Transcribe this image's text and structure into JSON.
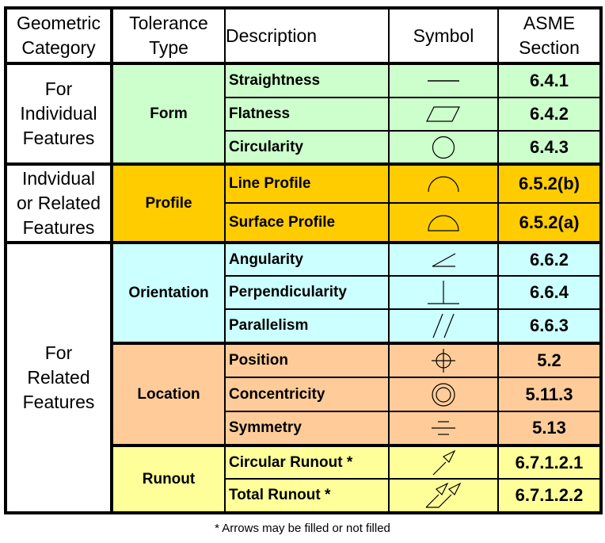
{
  "headers": {
    "category": "Geometric Category",
    "category_l1": "Geometric",
    "category_l2": "Category",
    "type_l1": "Tolerance",
    "type_l2": "Type",
    "description": "Description",
    "symbol": "Symbol",
    "section_l1": "ASME",
    "section_l2": "Section"
  },
  "categories": [
    {
      "lines": [
        "For",
        "Individual",
        "Features"
      ]
    },
    {
      "lines": [
        "Indvidual",
        "or Related",
        "Features"
      ]
    },
    {
      "lines": [
        "For",
        "Related",
        "Features"
      ]
    }
  ],
  "groups": [
    {
      "type": "Form",
      "color": "#ccffcc",
      "rows": [
        {
          "description": "Straightness",
          "symbol": "straightness-icon",
          "section": "6.4.1"
        },
        {
          "description": "Flatness",
          "symbol": "flatness-icon",
          "section": "6.4.2"
        },
        {
          "description": "Circularity",
          "symbol": "circularity-icon",
          "section": "6.4.3"
        }
      ]
    },
    {
      "type": "Profile",
      "color": "#ffcc00",
      "rows": [
        {
          "description": "Line Profile",
          "symbol": "line-profile-icon",
          "section": "6.5.2(b)"
        },
        {
          "description": "Surface Profile",
          "symbol": "surface-profile-icon",
          "section": "6.5.2(a)"
        }
      ]
    },
    {
      "type": "Orientation",
      "color": "#ccffff",
      "rows": [
        {
          "description": "Angularity",
          "symbol": "angularity-icon",
          "section": "6.6.2"
        },
        {
          "description": "Perpendicularity",
          "symbol": "perpendicularity-icon",
          "section": "6.6.4"
        },
        {
          "description": "Parallelism",
          "symbol": "parallelism-icon",
          "section": "6.6.3"
        }
      ]
    },
    {
      "type": "Location",
      "color": "#ffcc99",
      "rows": [
        {
          "description": "Position",
          "symbol": "position-icon",
          "section": "5.2"
        },
        {
          "description": "Concentricity",
          "symbol": "concentricity-icon",
          "section": "5.11.3"
        },
        {
          "description": "Symmetry",
          "symbol": "symmetry-icon",
          "section": "5.13"
        }
      ]
    },
    {
      "type": "Runout",
      "color": "#ffff99",
      "rows": [
        {
          "description": "Circular Runout *",
          "symbol": "circular-runout-icon",
          "section": "6.7.1.2.1"
        },
        {
          "description": "Total Runout *",
          "symbol": "total-runout-icon",
          "section": "6.7.1.2.2"
        }
      ]
    }
  ],
  "footnote": "* Arrows may be filled or not filled"
}
